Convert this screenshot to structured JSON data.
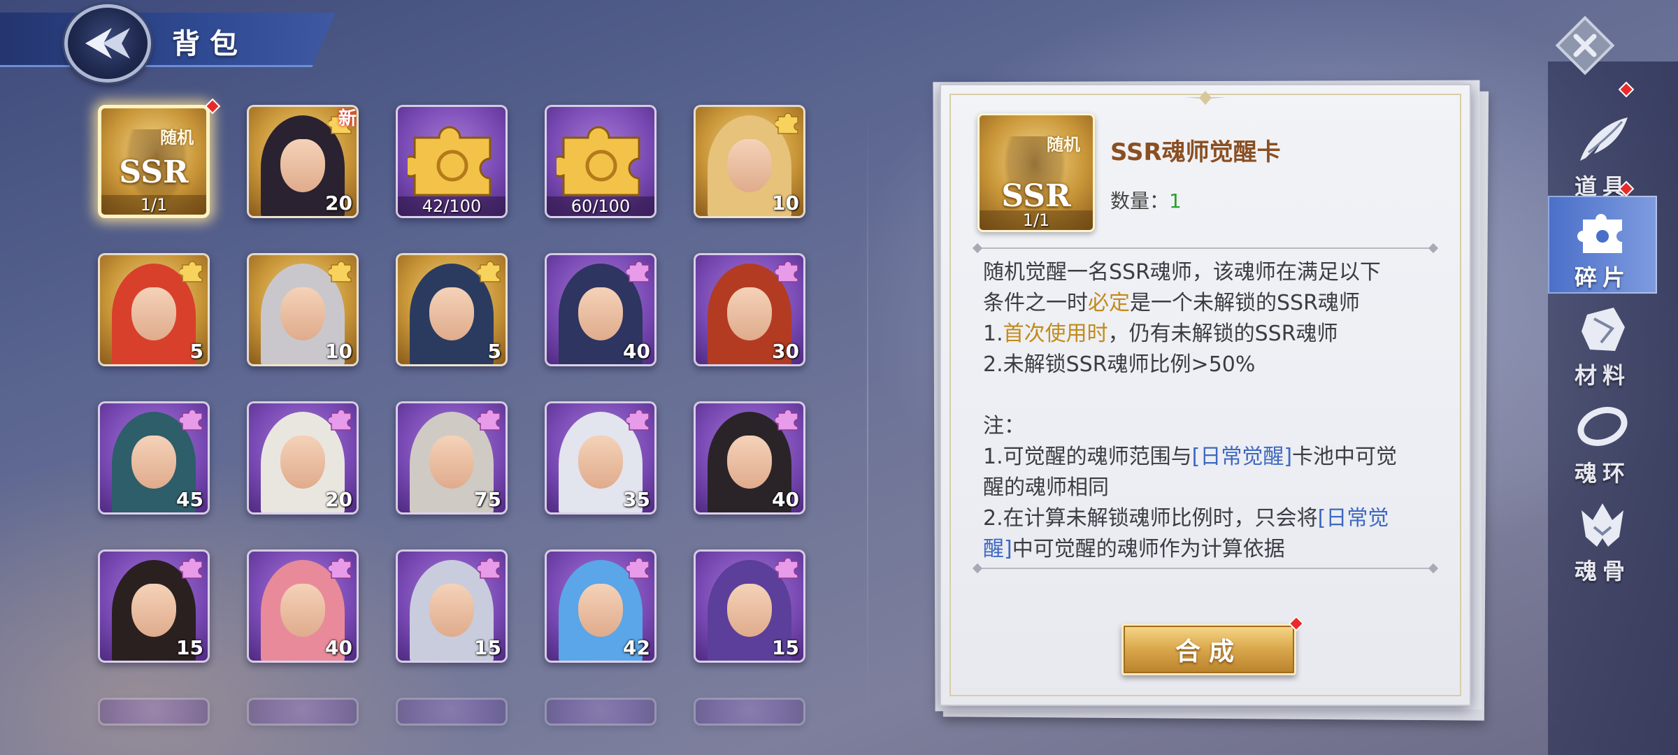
{
  "header": {
    "title": "背包"
  },
  "grid": {
    "rows": [
      [
        {
          "kind": "ssr-card",
          "sub": "随机",
          "main": "SSR",
          "progress": "1/1",
          "selected": true,
          "red_dot": true
        },
        {
          "kind": "hero",
          "tone": "gold",
          "count": "20",
          "tag": "puzzle-gold",
          "new": "新",
          "hair": "#2a2230"
        },
        {
          "kind": "puzzle",
          "tone": "purple",
          "progress": "42/100"
        },
        {
          "kind": "puzzle",
          "tone": "purple",
          "progress": "60/100"
        },
        {
          "kind": "hero",
          "tone": "gold",
          "count": "10",
          "tag": "puzzle-gold",
          "hair": "#e6c27a"
        }
      ],
      [
        {
          "kind": "hero",
          "tone": "gold",
          "count": "5",
          "tag": "puzzle-gold",
          "hair": "#d8402c"
        },
        {
          "kind": "hero",
          "tone": "gold",
          "count": "10",
          "tag": "puzzle-gold",
          "hair": "#c9c7cc"
        },
        {
          "kind": "hero",
          "tone": "gold",
          "count": "5",
          "tag": "puzzle-gold",
          "hair": "#2b3b60"
        },
        {
          "kind": "hero",
          "tone": "purple",
          "count": "40",
          "tag": "puzzle-pink",
          "hair": "#2d3560"
        },
        {
          "kind": "hero",
          "tone": "purple",
          "count": "30",
          "tag": "puzzle-pink",
          "hair": "#b33b22"
        }
      ],
      [
        {
          "kind": "hero",
          "tone": "purple",
          "count": "45",
          "tag": "puzzle-pink",
          "hair": "#2d5e6a"
        },
        {
          "kind": "hero",
          "tone": "purple",
          "count": "20",
          "tag": "puzzle-pink",
          "hair": "#e9e6e0"
        },
        {
          "kind": "hero",
          "tone": "purple",
          "count": "75",
          "tag": "puzzle-pink",
          "hair": "#cfcac4"
        },
        {
          "kind": "hero",
          "tone": "purple",
          "count": "35",
          "tag": "puzzle-pink",
          "hair": "#e2e4ee"
        },
        {
          "kind": "hero",
          "tone": "purple",
          "count": "40",
          "tag": "puzzle-pink",
          "hair": "#2a2428"
        }
      ],
      [
        {
          "kind": "hero",
          "tone": "purple",
          "count": "15",
          "tag": "puzzle-pink",
          "hair": "#2a2020"
        },
        {
          "kind": "hero",
          "tone": "purple",
          "count": "40",
          "tag": "puzzle-pink",
          "hair": "#e98a9a"
        },
        {
          "kind": "hero",
          "tone": "purple",
          "count": "15",
          "tag": "puzzle-pink",
          "hair": "#c8ccdc"
        },
        {
          "kind": "hero",
          "tone": "purple",
          "count": "42",
          "tag": "puzzle-pink",
          "hair": "#5aa6e8"
        },
        {
          "kind": "hero",
          "tone": "purple",
          "count": "15",
          "tag": "puzzle-pink",
          "hair": "#5b3f9a"
        }
      ]
    ]
  },
  "detail": {
    "icon_sub": "随机",
    "icon_main": "SSR",
    "icon_progress": "1/1",
    "name": "SSR魂师觉醒卡",
    "qty_label": "数量：",
    "qty_value": "1",
    "desc": {
      "line1": "随机觉醒一名SSR魂师，该魂师在满足以下",
      "line2_a": "条件之一时",
      "line2_hl": "必定",
      "line2_b": "是一个未解锁的SSR魂师",
      "line3_a": "1.",
      "line3_hl": "首次使用时",
      "line3_b": "，仍有未解锁的SSR魂师",
      "line4": "2.未解锁SSR魂师比例>50%",
      "note_title": "注：",
      "note1_a": "1.可觉醒的魂师范围与",
      "note1_hl": "[日常觉醒]",
      "note1_b": "卡池中可觉",
      "note1_c": "醒的魂师相同",
      "note2_a": "2.在计算未解锁魂师比例时，只会将",
      "note2_hl1": "[日常觉",
      "note2_hl2": "醒]",
      "note2_b": "中可觉醒的魂师作为计算依据"
    },
    "compose_label": "合成"
  },
  "nav": [
    {
      "id": "items",
      "label": "道具",
      "icon": "feather-icon",
      "active": false
    },
    {
      "id": "fragments",
      "label": "碎片",
      "icon": "puzzle-icon",
      "active": true
    },
    {
      "id": "materials",
      "label": "材料",
      "icon": "ore-icon",
      "active": false
    },
    {
      "id": "soul-rings",
      "label": "魂环",
      "icon": "ring-icon",
      "active": false
    },
    {
      "id": "soul-bones",
      "label": "魂骨",
      "icon": "bone-icon",
      "active": false
    }
  ],
  "colors": {
    "gold_tile": "#c99638",
    "purple_tile": "#7748b2",
    "nav_active": "#4a6fc8",
    "highlight_gold": "#c38a18",
    "highlight_blue": "#3e68c0",
    "qty_green": "#2aa02a",
    "name_brown": "#8a4f22"
  }
}
